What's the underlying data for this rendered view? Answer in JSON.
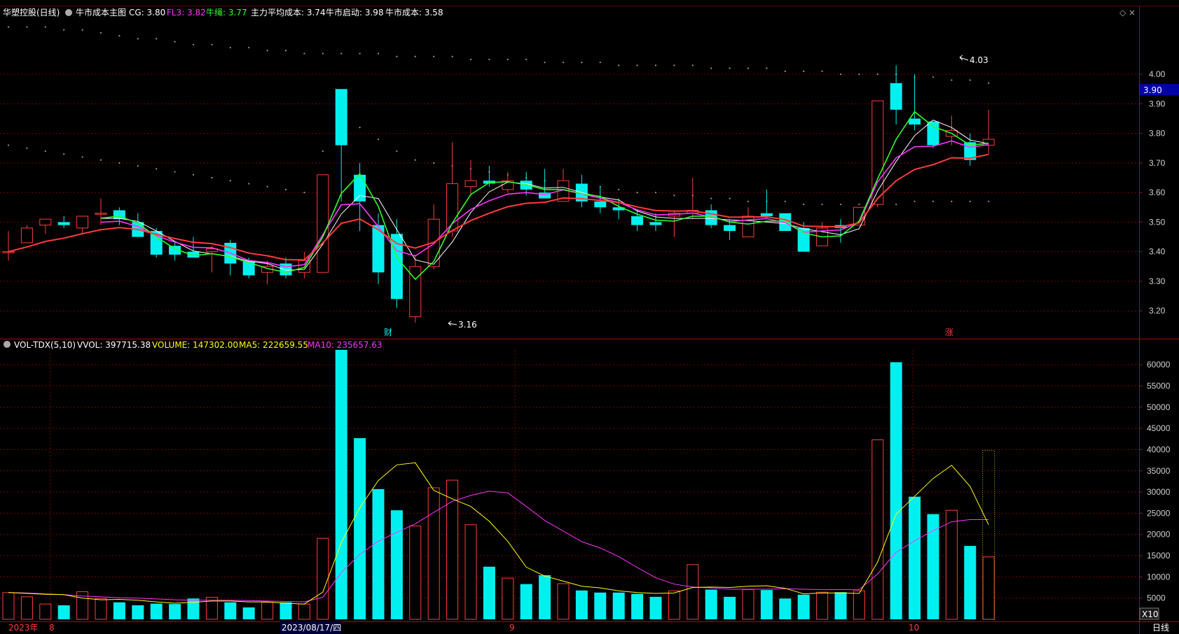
{
  "top_info": {
    "stock_name": "华塑控股(日线)",
    "indicator_name": "牛市成本主图",
    "cg": "CG: 3.80",
    "fl3": "FL3: 3.82",
    "niushen": "牛绳: 3.77",
    "main_avg_cost": "主力平均成本: 3.74",
    "bull_start": "牛市启动: 3.98",
    "bull_cost": "牛市成本: 3.58"
  },
  "vol_info": {
    "name": "VOL-TDX(5,10)",
    "vvol": "VVOL: 397715.38",
    "volume": "VOLUME: 147302.00",
    "ma5": "MA5: 222659.55",
    "ma10": "MA10: 235657.63"
  },
  "annotations": {
    "high_label": "4.03",
    "low_label": "3.16",
    "cai_marker": "财",
    "zhang_marker": "涨",
    "price_flag": "3.90",
    "x10": "X10"
  },
  "x_axis": {
    "year_label": "2023年",
    "m8": "8",
    "date_cursor": "2023/08/17/四",
    "m9": "9",
    "m10": "10",
    "period": "日线"
  },
  "colors": {
    "up": "#ff3b3b",
    "down": "#00f0f0",
    "magenta": "#ff33ff",
    "green": "#2bff2b",
    "yellow": "#ffff00",
    "white": "#ffffff",
    "grid": "#7a0000",
    "border": "#b00000",
    "flag_bg": "#0000aa"
  },
  "chart_data": {
    "type": "candlestick",
    "price_ticks": [
      "3.20",
      "3.30",
      "3.40",
      "3.50",
      "3.60",
      "3.70",
      "3.80",
      "3.90",
      "4.00"
    ],
    "price_range": [
      3.12,
      4.18
    ],
    "volume_ticks": [
      "5000",
      "10000",
      "15000",
      "20000",
      "25000",
      "30000",
      "35000",
      "40000",
      "45000",
      "50000",
      "55000",
      "60000"
    ],
    "volume_range": [
      0,
      63500
    ],
    "candles": [
      {
        "o": 3.4,
        "h": 3.47,
        "l": 3.37,
        "c": 3.4
      },
      {
        "o": 3.43,
        "h": 3.49,
        "l": 3.43,
        "c": 3.48
      },
      {
        "o": 3.49,
        "h": 3.51,
        "l": 3.46,
        "c": 3.51
      },
      {
        "o": 3.5,
        "h": 3.52,
        "l": 3.48,
        "c": 3.49
      },
      {
        "o": 3.48,
        "h": 3.52,
        "l": 3.46,
        "c": 3.52
      },
      {
        "o": 3.53,
        "h": 3.58,
        "l": 3.49,
        "c": 3.53
      },
      {
        "o": 3.54,
        "h": 3.55,
        "l": 3.49,
        "c": 3.51
      },
      {
        "o": 3.5,
        "h": 3.53,
        "l": 3.45,
        "c": 3.45
      },
      {
        "o": 3.47,
        "h": 3.48,
        "l": 3.38,
        "c": 3.39
      },
      {
        "o": 3.42,
        "h": 3.43,
        "l": 3.37,
        "c": 3.39
      },
      {
        "o": 3.4,
        "h": 3.45,
        "l": 3.38,
        "c": 3.38
      },
      {
        "o": 3.4,
        "h": 3.42,
        "l": 3.33,
        "c": 3.41
      },
      {
        "o": 3.43,
        "h": 3.44,
        "l": 3.32,
        "c": 3.36
      },
      {
        "o": 3.37,
        "h": 3.38,
        "l": 3.31,
        "c": 3.32
      },
      {
        "o": 3.33,
        "h": 3.37,
        "l": 3.29,
        "c": 3.35
      },
      {
        "o": 3.36,
        "h": 3.38,
        "l": 3.31,
        "c": 3.32
      },
      {
        "o": 3.33,
        "h": 3.4,
        "l": 3.31,
        "c": 3.37
      },
      {
        "o": 3.33,
        "h": 3.66,
        "l": 3.33,
        "c": 3.66
      },
      {
        "o": 3.95,
        "h": 3.95,
        "l": 3.57,
        "c": 3.76
      },
      {
        "o": 3.66,
        "h": 3.7,
        "l": 3.47,
        "c": 3.57
      },
      {
        "o": 3.49,
        "h": 3.53,
        "l": 3.29,
        "c": 3.33
      },
      {
        "o": 3.46,
        "h": 3.51,
        "l": 3.21,
        "c": 3.24
      },
      {
        "o": 3.18,
        "h": 3.39,
        "l": 3.16,
        "c": 3.35
      },
      {
        "o": 3.35,
        "h": 3.56,
        "l": 3.34,
        "c": 3.51
      },
      {
        "o": 3.47,
        "h": 3.77,
        "l": 3.45,
        "c": 3.63
      },
      {
        "o": 3.62,
        "h": 3.71,
        "l": 3.59,
        "c": 3.64
      },
      {
        "o": 3.64,
        "h": 3.69,
        "l": 3.62,
        "c": 3.63
      },
      {
        "o": 3.61,
        "h": 3.67,
        "l": 3.6,
        "c": 3.64
      },
      {
        "o": 3.64,
        "h": 3.67,
        "l": 3.59,
        "c": 3.61
      },
      {
        "o": 3.6,
        "h": 3.68,
        "l": 3.58,
        "c": 3.58
      },
      {
        "o": 3.57,
        "h": 3.68,
        "l": 3.57,
        "c": 3.64
      },
      {
        "o": 3.63,
        "h": 3.66,
        "l": 3.55,
        "c": 3.57
      },
      {
        "o": 3.57,
        "h": 3.62,
        "l": 3.53,
        "c": 3.55
      },
      {
        "o": 3.55,
        "h": 3.58,
        "l": 3.51,
        "c": 3.54
      },
      {
        "o": 3.52,
        "h": 3.54,
        "l": 3.47,
        "c": 3.49
      },
      {
        "o": 3.5,
        "h": 3.53,
        "l": 3.47,
        "c": 3.49
      },
      {
        "o": 3.52,
        "h": 3.54,
        "l": 3.45,
        "c": 3.53
      },
      {
        "o": 3.53,
        "h": 3.65,
        "l": 3.51,
        "c": 3.54
      },
      {
        "o": 3.54,
        "h": 3.56,
        "l": 3.48,
        "c": 3.49
      },
      {
        "o": 3.49,
        "h": 3.51,
        "l": 3.44,
        "c": 3.47
      },
      {
        "o": 3.45,
        "h": 3.55,
        "l": 3.45,
        "c": 3.52
      },
      {
        "o": 3.53,
        "h": 3.61,
        "l": 3.51,
        "c": 3.52
      },
      {
        "o": 3.53,
        "h": 3.53,
        "l": 3.47,
        "c": 3.47
      },
      {
        "o": 3.48,
        "h": 3.5,
        "l": 3.4,
        "c": 3.4
      },
      {
        "o": 3.42,
        "h": 3.5,
        "l": 3.42,
        "c": 3.48
      },
      {
        "o": 3.49,
        "h": 3.51,
        "l": 3.43,
        "c": 3.48
      },
      {
        "o": 3.49,
        "h": 3.55,
        "l": 3.49,
        "c": 3.55
      },
      {
        "o": 3.56,
        "h": 3.91,
        "l": 3.55,
        "c": 3.91
      },
      {
        "o": 3.97,
        "h": 4.03,
        "l": 3.83,
        "c": 3.88
      },
      {
        "o": 3.85,
        "h": 4.0,
        "l": 3.81,
        "c": 3.83
      },
      {
        "o": 3.84,
        "h": 3.84,
        "l": 3.75,
        "c": 3.76
      },
      {
        "o": 3.79,
        "h": 3.86,
        "l": 3.76,
        "c": 3.81
      },
      {
        "o": 3.77,
        "h": 3.8,
        "l": 3.69,
        "c": 3.71
      },
      {
        "o": 3.76,
        "h": 3.88,
        "l": 3.73,
        "c": 3.78
      }
    ],
    "volumes": [
      6300,
      5300,
      3600,
      3300,
      6500,
      4900,
      4000,
      3300,
      3700,
      3600,
      4900,
      5200,
      4000,
      2800,
      4000,
      4000,
      3600,
      19100,
      63500,
      42700,
      30700,
      25700,
      22000,
      31000,
      32800,
      22300,
      12400,
      9700,
      8300,
      10400,
      8400,
      6800,
      6300,
      6300,
      6000,
      5300,
      6700,
      12900,
      7000,
      5300,
      7000,
      6900,
      4900,
      5800,
      6400,
      6400,
      6700,
      42300,
      60600,
      28900,
      24800,
      25700,
      17300,
      14700
    ],
    "vol_ma5": [
      6300,
      6100,
      5900,
      5800,
      5000,
      4600,
      4700,
      4500,
      4100,
      3800,
      4000,
      4300,
      4300,
      4100,
      4100,
      3800,
      3600,
      6400,
      18100,
      26300,
      32700,
      36400,
      36900,
      30400,
      28400,
      26600,
      23100,
      18400,
      12300,
      10200,
      9000,
      7800,
      7400,
      6700,
      6300,
      6100,
      6200,
      7500,
      7600,
      7500,
      7800,
      7900,
      7300,
      6000,
      6200,
      6200,
      6100,
      13500,
      24800,
      29000,
      33200,
      36300,
      31300,
      22300
    ],
    "vol_ma10": [
      6300,
      6200,
      6000,
      5800,
      5500,
      5300,
      5100,
      5000,
      4800,
      4600,
      4500,
      4500,
      4500,
      4400,
      4300,
      4200,
      4100,
      5200,
      11000,
      15300,
      18400,
      20500,
      22500,
      25200,
      27800,
      29200,
      30200,
      29800,
      26600,
      23300,
      20800,
      18300,
      16800,
      14800,
      12200,
      9800,
      8300,
      7600,
      7400,
      7100,
      7100,
      7100,
      7200,
      7100,
      7000,
      7000,
      7000,
      10700,
      15800,
      18500,
      20900,
      23000,
      23500,
      23500
    ]
  }
}
